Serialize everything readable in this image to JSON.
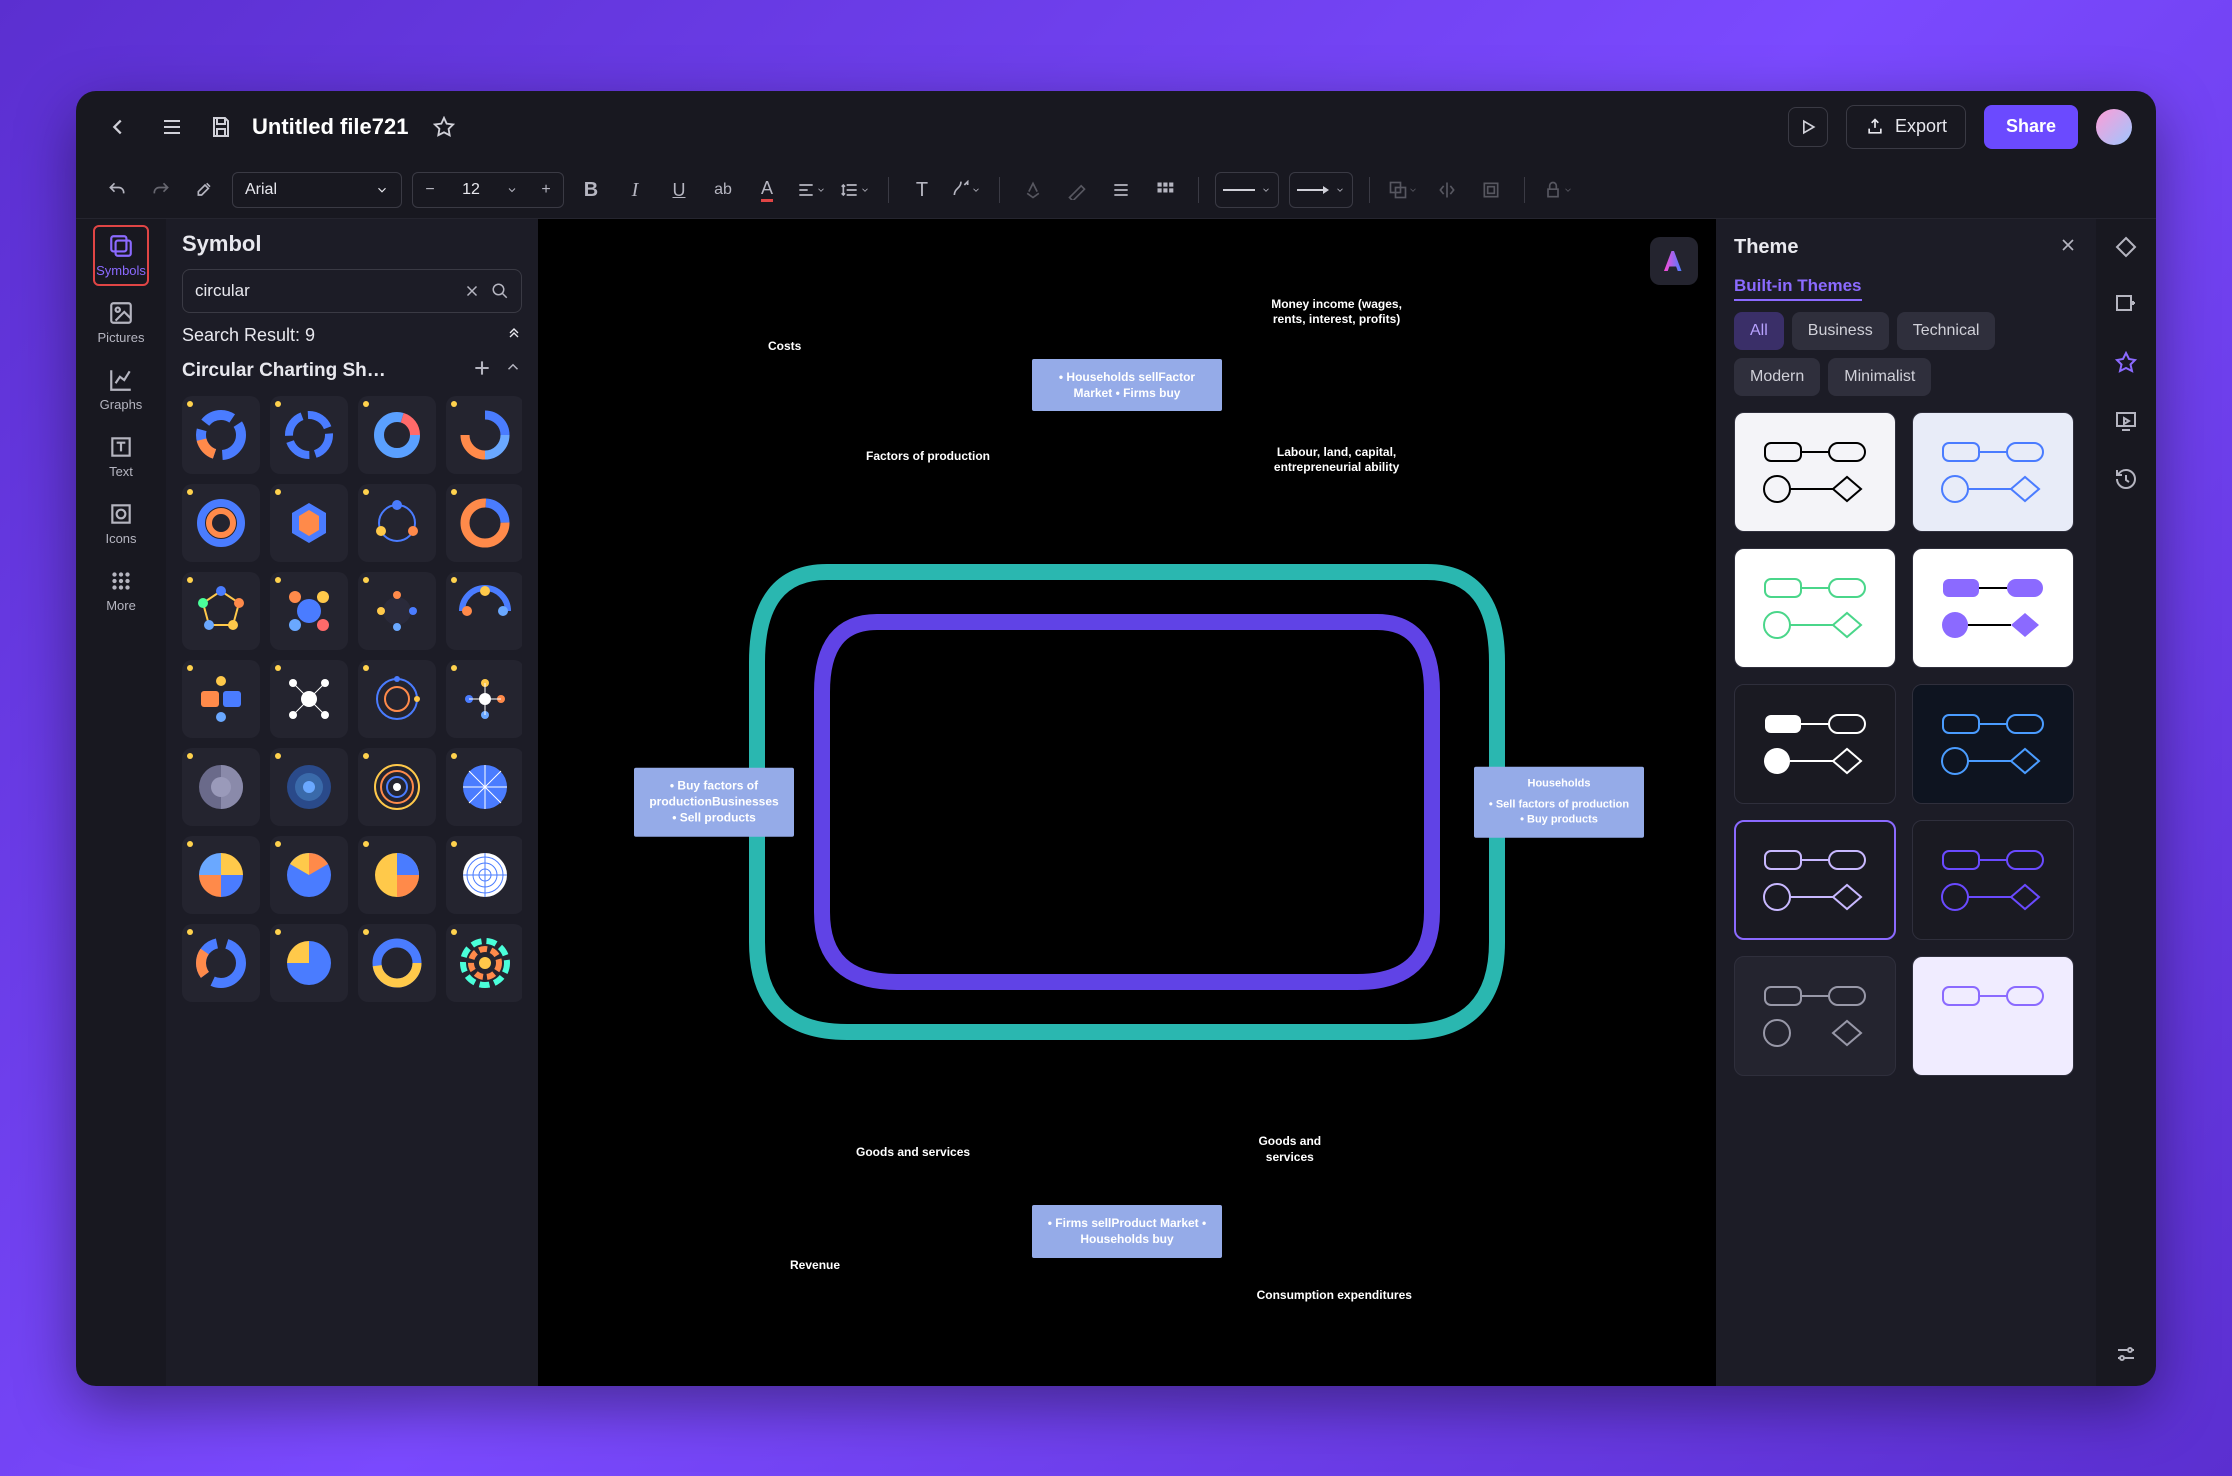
{
  "header": {
    "file_title": "Untitled file721",
    "export_label": "Export",
    "share_label": "Share"
  },
  "toolbar": {
    "font": "Arial",
    "font_size": "12"
  },
  "left_rail": {
    "items": [
      "Symbols",
      "Pictures",
      "Graphs",
      "Text",
      "Icons",
      "More"
    ]
  },
  "symbol_panel": {
    "title": "Symbol",
    "search_value": "circular",
    "result_label": "Search Result: 9",
    "section_label": "Circular Charting Sh…"
  },
  "theme_panel": {
    "title": "Theme",
    "tab_link": "Built-in Themes",
    "filters": [
      "All",
      "Business",
      "Technical",
      "Modern",
      "Minimalist"
    ]
  },
  "canvas": {
    "boxes": {
      "top": "• Households sellFactor Market\n• Firms buy",
      "left": "• Buy factors of productionBusinesses\n• Sell products",
      "right_title": "Households",
      "right_body": "• Sell factors of production\n• Buy products",
      "bottom": "• Firms sellProduct Market\n• Households buy"
    },
    "labels": {
      "money_income": "Money income (wages, rents, interest, profits)",
      "costs": "Costs",
      "factors_of_production": "Factors of production",
      "labour": "Labour, land, capital, entrepreneurial ability",
      "goods_services_left": "Goods and services",
      "goods_services_right": "Goods and\nservices",
      "revenue": "Revenue",
      "consumption": "Consumption expenditures"
    }
  }
}
